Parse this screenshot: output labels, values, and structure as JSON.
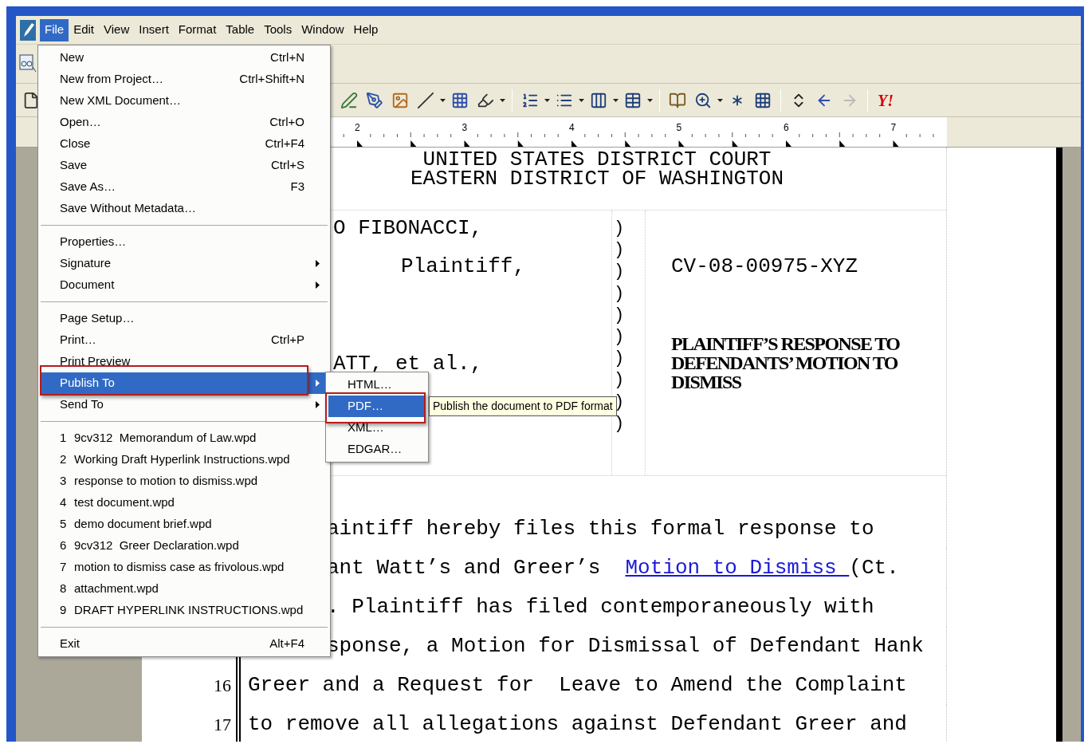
{
  "menubar": [
    {
      "label": "File",
      "selected": true
    },
    {
      "label": "Edit",
      "selected": false
    },
    {
      "label": "View",
      "selected": false
    },
    {
      "label": "Insert",
      "selected": false
    },
    {
      "label": "Format",
      "selected": false
    },
    {
      "label": "Table",
      "selected": false
    },
    {
      "label": "Tools",
      "selected": false
    },
    {
      "label": "Window",
      "selected": false
    },
    {
      "label": "Help",
      "selected": false
    }
  ],
  "toolbar": {
    "logo_text": "Y!"
  },
  "ruler": {
    "numbers": [
      "2",
      "3",
      "4",
      "5",
      "6",
      "7"
    ]
  },
  "file_menu": {
    "items": [
      {
        "kind": "item",
        "label": "New",
        "shortcut": "Ctrl+N",
        "submenu": false,
        "selected": false
      },
      {
        "kind": "item",
        "label": "New from Project…",
        "shortcut": "Ctrl+Shift+N",
        "submenu": false,
        "selected": false
      },
      {
        "kind": "item",
        "label": "New XML Document…",
        "submenu": false,
        "selected": false
      },
      {
        "kind": "item",
        "label": "Open…",
        "shortcut": "Ctrl+O",
        "submenu": false,
        "selected": false
      },
      {
        "kind": "item",
        "label": "Close",
        "shortcut": "Ctrl+F4",
        "submenu": false,
        "selected": false
      },
      {
        "kind": "item",
        "label": "Save",
        "shortcut": "Ctrl+S",
        "submenu": false,
        "selected": false
      },
      {
        "kind": "item",
        "label": "Save As…",
        "shortcut": "F3",
        "submenu": false,
        "selected": false
      },
      {
        "kind": "item",
        "label": "Save Without Metadata…",
        "submenu": false,
        "selected": false
      },
      {
        "kind": "separator"
      },
      {
        "kind": "item",
        "label": "Properties…",
        "submenu": false,
        "selected": false
      },
      {
        "kind": "item",
        "label": "Signature",
        "submenu": true,
        "selected": false
      },
      {
        "kind": "item",
        "label": "Document",
        "submenu": true,
        "selected": false
      },
      {
        "kind": "separator"
      },
      {
        "kind": "item",
        "label": "Page Setup…",
        "submenu": false,
        "selected": false
      },
      {
        "kind": "item",
        "label": "Print…",
        "shortcut": "Ctrl+P",
        "submenu": false,
        "selected": false
      },
      {
        "kind": "item",
        "label": "Print Preview",
        "submenu": false,
        "selected": false
      },
      {
        "kind": "item",
        "label": "Publish To",
        "submenu": true,
        "selected": true
      },
      {
        "kind": "item",
        "label": "Send To",
        "submenu": true,
        "selected": false
      },
      {
        "kind": "separator"
      },
      {
        "kind": "recent",
        "number": "1",
        "label": "9cv312  Memorandum of Law.wpd",
        "selected": false
      },
      {
        "kind": "recent",
        "number": "2",
        "label": "Working Draft Hyperlink Instructions.wpd",
        "selected": false
      },
      {
        "kind": "recent",
        "number": "3",
        "label": "response to motion to dismiss.wpd",
        "selected": false
      },
      {
        "kind": "recent",
        "number": "4",
        "label": "test document.wpd",
        "selected": false
      },
      {
        "kind": "recent",
        "number": "5",
        "label": "demo document brief.wpd",
        "selected": false
      },
      {
        "kind": "recent",
        "number": "6",
        "label": "9cv312  Greer Declaration.wpd",
        "selected": false
      },
      {
        "kind": "recent",
        "number": "7",
        "label": "motion to dismiss case as frivolous.wpd",
        "selected": false
      },
      {
        "kind": "recent",
        "number": "8",
        "label": "attachment.wpd",
        "selected": false
      },
      {
        "kind": "recent",
        "number": "9",
        "label": "DRAFT HYPERLINK INSTRUCTIONS.wpd",
        "selected": false
      },
      {
        "kind": "separator"
      },
      {
        "kind": "item",
        "label": "Exit",
        "shortcut": "Alt+F4",
        "submenu": false,
        "selected": false
      }
    ]
  },
  "publish_submenu": {
    "items": [
      {
        "label": "HTML…",
        "selected": false
      },
      {
        "label": "PDF…",
        "selected": true
      },
      {
        "label": "XML…",
        "selected": false
      },
      {
        "label": "EDGAR…",
        "selected": false
      }
    ]
  },
  "tooltip": "Publish the document to PDF format",
  "document": {
    "caption": [
      "UNITED STATES DISTRICT COURT",
      "EASTERN DISTRICT OF WASHINGTON"
    ],
    "parties": [
      {
        "kind": "name",
        "text": "O FIBONACCI,"
      },
      {
        "kind": "role",
        "text": "Plaintiff,"
      },
      {
        "kind": "name",
        "text": "ATT, et al.,"
      }
    ],
    "parens": [
      ")",
      ")",
      ")",
      ")",
      ")",
      ")",
      ")",
      ")",
      ")",
      ")"
    ],
    "case_number": "CV-08-00975-XYZ",
    "title": "PLAINTIFF’S RESPONSE TO DEFENDANTS’ MOTION TO DISMISS",
    "lines": [
      {
        "text": "aintiff hereby files this formal response to"
      },
      {
        "segments": [
          {
            "kind": "plain",
            "text": "ant Watt’s and Greer’s  "
          },
          {
            "kind": "link",
            "text": "Motion to Dismiss "
          },
          {
            "kind": "plain",
            "text": "(Ct."
          }
        ]
      },
      {
        "text": ". Plaintiff has filed contemporaneously with"
      },
      {
        "text": "sponse, a Motion for Dismissal of Defendant Hank"
      },
      {
        "number": "16",
        "text": "Greer and a Request for  Leave to Amend the Complaint"
      },
      {
        "number": "17",
        "text": "to remove all allegations against Defendant Greer and"
      }
    ]
  }
}
